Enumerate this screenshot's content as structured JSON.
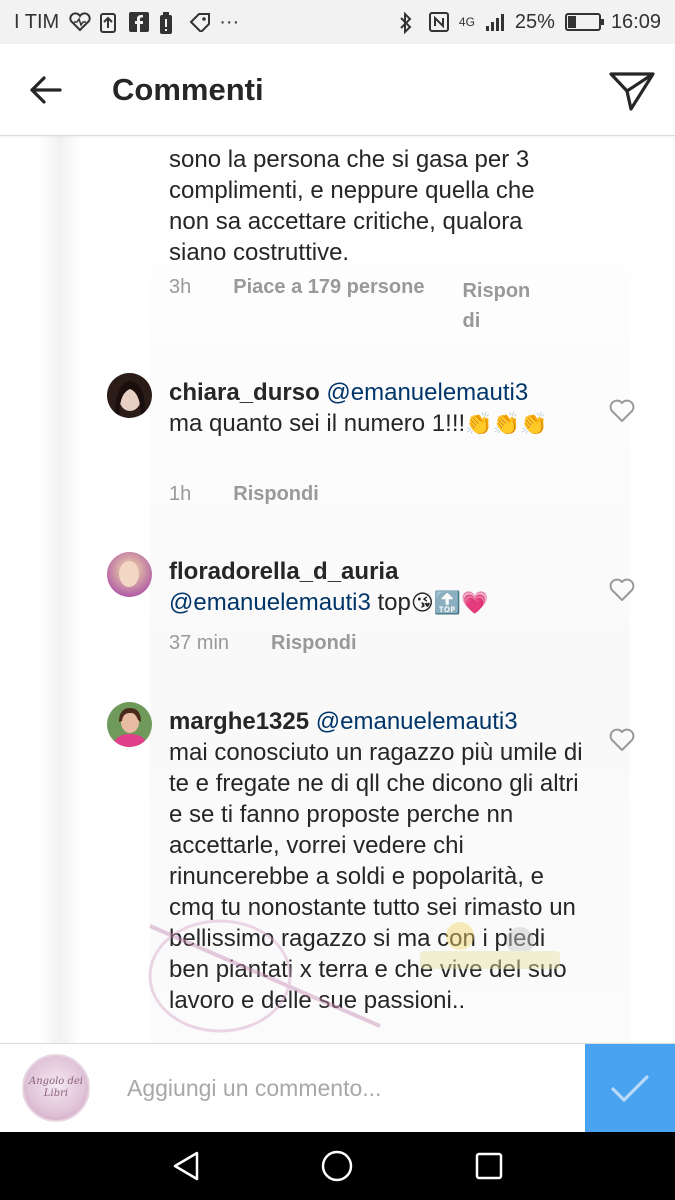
{
  "status_bar": {
    "carrier": "I TIM",
    "network": "4G",
    "battery_percent": "25%",
    "battery_level": 0.25,
    "time": "16:09"
  },
  "header": {
    "title": "Commenti",
    "back_icon": "arrow-left-icon",
    "send_icon": "paper-plane-icon"
  },
  "comments": [
    {
      "username": "",
      "text": "sono la persona che si gasa per 3 complimenti, e neppure quella che non sa accettare critiche, qualora siano costruttive.",
      "time": "3h",
      "likes": "Piace a 179 persone",
      "reply": "Rispon di"
    },
    {
      "username": "chiara_durso",
      "mention": "@emanuelemauti3",
      "text": "ma quanto sei il numero 1!!!",
      "emoji": "👏👏👏",
      "time": "1h",
      "reply": "Rispondi"
    },
    {
      "username": "floradorella_d_auria",
      "mention": "@emanuelemauti3",
      "text": "top",
      "emoji": "😘🔝💗",
      "time": "37 min",
      "reply": "Rispondi"
    },
    {
      "username": "marghe1325",
      "mention": "@emanuelemauti3",
      "text": "mai conosciuto un ragazzo più umile di te e fregate ne di qll che dicono gli altri e se ti fanno proposte perche nn accettarle, vorrei vedere chi rinuncerebbe a soldi e popolarità, e cmq tu nonostante tutto sei rimasto un bellissimo ragazzo si ma con i piedi ben piantati x terra e che vive del suo lavoro e delle sue passioni.."
    }
  ],
  "composer": {
    "placeholder": "Aggiungi un commento...",
    "avatar_label": "Angolo dei Libri"
  },
  "colors": {
    "accent": "#4aa3f0",
    "mention": "#003569",
    "meta_gray": "#999999"
  }
}
